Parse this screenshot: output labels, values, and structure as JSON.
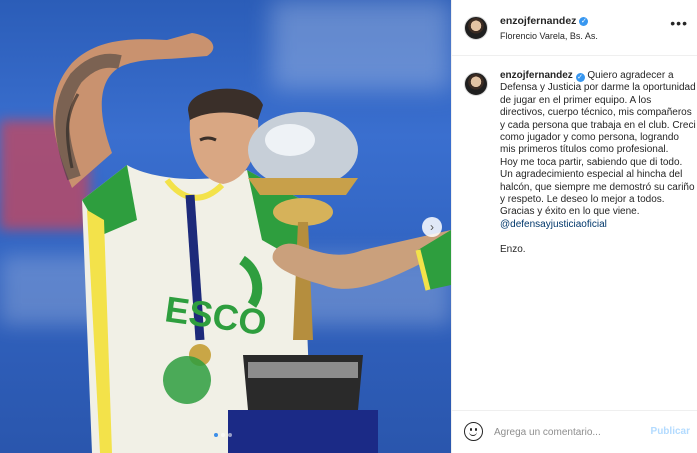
{
  "post": {
    "username": "enzojfernandez",
    "location": "Florencio Varela, Bs. As.",
    "verified": true
  },
  "caption": {
    "username": "enzojfernandez",
    "body": "Quiero agradecer a Defensa y Justicia por darme la oportunidad de jugar en el primer equipo. A los directivos, cuerpo técnico, mis compañeros y cada persona que trabaja en el club. Creci como jugador y como persona, logrando mis primeros títulos como profesional.\nHoy me toca partir, sabiendo que di todo. Un agradecimiento especial al hincha del halcón, que siempre me demostró su cariño y respeto. Le deseo lo mejor a todos.\nGracias y éxito en lo que viene.",
    "mention": "@defensayjusticiaoficial",
    "signoff": "Enzo."
  },
  "comment": {
    "placeholder": "Agrega un comentario...",
    "publish_label": "Publicar"
  },
  "carousel": {
    "total_slides": 3,
    "current_slide": 1
  },
  "colors": {
    "verified": "#3897f0",
    "mention": "#00376b",
    "publish_disabled": "#b3dbff",
    "jersey_green": "#2e9e3e",
    "jersey_yellow": "#f3e24a"
  },
  "icons": {
    "more": "more-horizontal-icon",
    "emoji": "smile-icon",
    "next": "chevron-right-icon"
  }
}
